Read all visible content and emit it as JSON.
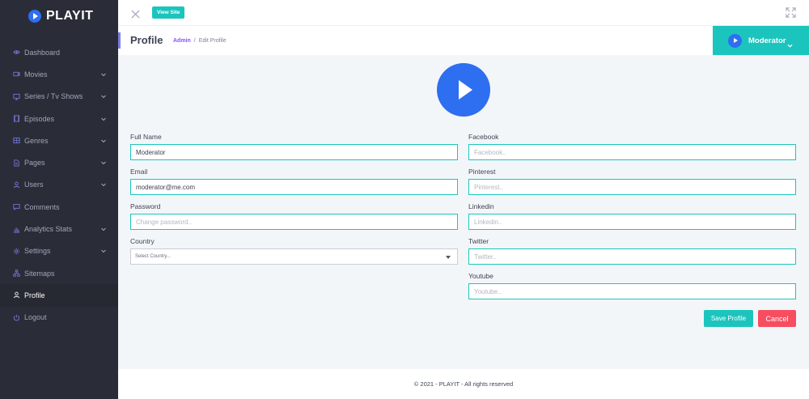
{
  "brand": {
    "name": "PLAYIT"
  },
  "sidebar": {
    "items": [
      {
        "label": "Dashboard",
        "icon": "eye-icon",
        "has_children": false
      },
      {
        "label": "Movies",
        "icon": "video-icon",
        "has_children": true
      },
      {
        "label": "Series / Tv Shows",
        "icon": "monitor-icon",
        "has_children": true
      },
      {
        "label": "Episodes",
        "icon": "film-icon",
        "has_children": true
      },
      {
        "label": "Genres",
        "icon": "grid-icon",
        "has_children": true
      },
      {
        "label": "Pages",
        "icon": "document-icon",
        "has_children": true
      },
      {
        "label": "Users",
        "icon": "user-icon",
        "has_children": true
      },
      {
        "label": "Comments",
        "icon": "comment-icon",
        "has_children": false
      },
      {
        "label": "Analytics Stats",
        "icon": "bar-chart-icon",
        "has_children": true
      },
      {
        "label": "Settings",
        "icon": "gear-icon",
        "has_children": true
      },
      {
        "label": "Sitemaps",
        "icon": "sitemap-icon",
        "has_children": false
      },
      {
        "label": "Profile",
        "icon": "user-icon",
        "has_children": false,
        "active": true
      },
      {
        "label": "Logout",
        "icon": "power-icon",
        "has_children": false
      }
    ]
  },
  "topbar": {
    "view_site_label": "View Site"
  },
  "subheader": {
    "title": "Profile",
    "breadcrumb": {
      "link": "Admin",
      "separator": "/",
      "current": "Edit Profile"
    },
    "user_name": "Moderator"
  },
  "form": {
    "full_name": {
      "label": "Full Name",
      "value": "Moderator"
    },
    "email": {
      "label": "Email",
      "value": "moderator@me.com"
    },
    "password": {
      "label": "Password",
      "placeholder": "Change password.."
    },
    "country": {
      "label": "Country",
      "selected": "Select Country..."
    },
    "facebook": {
      "label": "Facebook",
      "placeholder": "Facebook.."
    },
    "pinterest": {
      "label": "Pinterest",
      "placeholder": "Pinterest.."
    },
    "linkedin": {
      "label": "Linkedin",
      "placeholder": "Linkedin.."
    },
    "twitter": {
      "label": "Twitter",
      "placeholder": "Twitter.."
    },
    "youtube": {
      "label": "Youtube",
      "placeholder": "Youtube.."
    },
    "save_label": "Save Profile",
    "cancel_label": "Cancel"
  },
  "footer": {
    "text": "© 2021 - PLAYIT - All rights reserved"
  },
  "colors": {
    "accent": "#1bc5bd",
    "danger": "#f64e60",
    "brand_blue": "#2e6ef0",
    "sidebar_bg": "#2a2d37",
    "link_purple": "#8950fc"
  }
}
